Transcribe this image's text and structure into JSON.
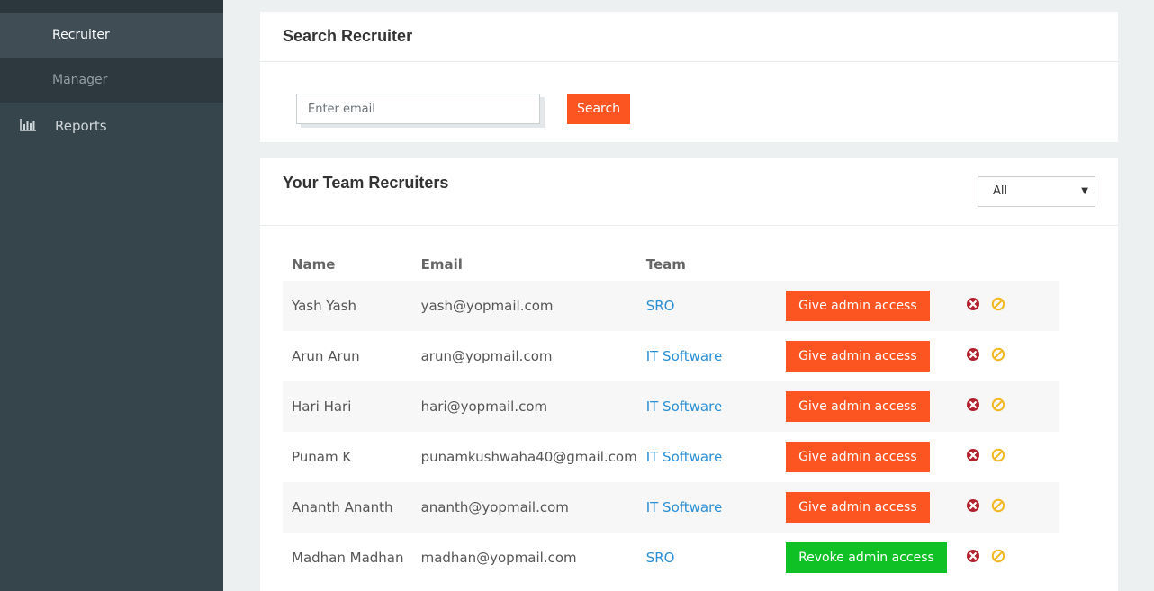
{
  "sidebar": {
    "sub_items": [
      {
        "label": "Recruiter",
        "active": true
      },
      {
        "label": "Manager",
        "active": false
      }
    ],
    "nav_items": [
      {
        "label": "Reports",
        "icon": "bar-chart-icon"
      }
    ]
  },
  "search_panel": {
    "title": "Search Recruiter",
    "email_placeholder": "Enter email",
    "search_label": "Search"
  },
  "team_panel": {
    "title": "Your Team Recruiters",
    "filter_selected": "All",
    "columns": [
      "Name",
      "Email",
      "Team"
    ],
    "rows": [
      {
        "name": "Yash Yash",
        "email": "yash@yopmail.com",
        "team": "SRO",
        "action": "Give admin access",
        "admin": false
      },
      {
        "name": "Arun Arun",
        "email": "arun@yopmail.com",
        "team": "IT Software",
        "action": "Give admin access",
        "admin": false
      },
      {
        "name": "Hari Hari",
        "email": "hari@yopmail.com",
        "team": "IT Software",
        "action": "Give admin access",
        "admin": false
      },
      {
        "name": "Punam K",
        "email": "punamkushwaha40@gmail.com",
        "team": "IT Software",
        "action": "Give admin access",
        "admin": false
      },
      {
        "name": "Ananth Ananth",
        "email": "ananth@yopmail.com",
        "team": "IT Software",
        "action": "Give admin access",
        "admin": false
      },
      {
        "name": "Madhan Madhan",
        "email": "madhan@yopmail.com",
        "team": "SRO",
        "action": "Revoke admin access",
        "admin": true
      }
    ]
  },
  "colors": {
    "accent_orange": "#fd5521",
    "revoke_green": "#10c126",
    "link_blue": "#2a8fd6",
    "delete_red": "#b3202e",
    "block_yellow": "#f2b824",
    "sidebar_bg": "#36444c"
  }
}
